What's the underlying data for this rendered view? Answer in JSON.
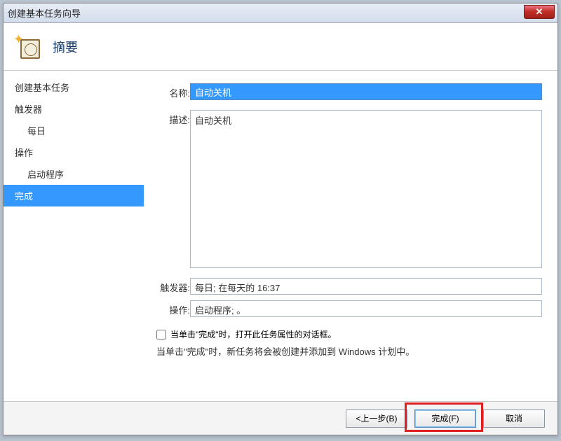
{
  "window": {
    "title": "创建基本任务向导"
  },
  "header": {
    "title": "摘要"
  },
  "sidebar": {
    "items": [
      {
        "label": "创建基本任务",
        "sub": false,
        "selected": false
      },
      {
        "label": "触发器",
        "sub": false,
        "selected": false
      },
      {
        "label": "每日",
        "sub": true,
        "selected": false
      },
      {
        "label": "操作",
        "sub": false,
        "selected": false
      },
      {
        "label": "启动程序",
        "sub": true,
        "selected": false
      },
      {
        "label": "完成",
        "sub": false,
        "selected": true
      }
    ]
  },
  "form": {
    "name_label": "名称:",
    "name_value": "自动关机",
    "desc_label": "描述:",
    "desc_value": "自动关机",
    "trigger_label": "触发器:",
    "trigger_value": "每日; 在每天的 16:37",
    "action_label": "操作:",
    "action_value": "启动程序; 。",
    "checkbox_label": "当单击\"完成\"时，打开此任务属性的对话框。",
    "info_text": "当单击\"完成\"时，新任务将会被创建并添加到 Windows 计划中。"
  },
  "buttons": {
    "back": "<上一步(B)",
    "finish": "完成(F)",
    "cancel": "取消"
  }
}
